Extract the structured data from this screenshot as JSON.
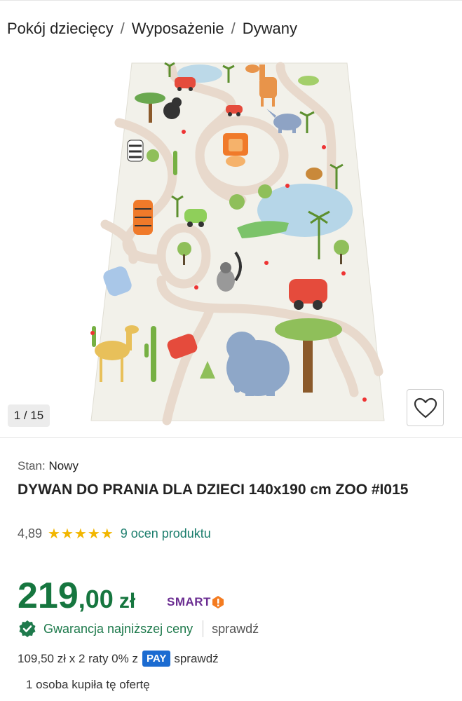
{
  "breadcrumb": {
    "items": [
      "Pokój dziecięcy",
      "Wyposażenie",
      "Dywany"
    ],
    "separator": "/"
  },
  "gallery": {
    "counter": "1 / 15",
    "image_alt": "Dywan do prania dla dzieci ZOO",
    "favorite_icon": "heart-icon"
  },
  "product": {
    "condition_label": "Stan:",
    "condition_value": "Nowy",
    "title": "DYWAN DO PRANIA DLA DZIECI 140x190 cm ZOO #I015",
    "rating_value": "4,89",
    "rating_stars": 5,
    "reviews_text": "9 ocen produktu"
  },
  "price": {
    "integer": "219",
    "decimal": ",00",
    "currency": "zł",
    "smart_label": "SMART"
  },
  "guarantee": {
    "text": "Gwarancja najniższej ceny",
    "check_link": "sprawdź"
  },
  "installments": {
    "text": "109,50 zł x 2 raty 0% z",
    "pay_badge": "PAY",
    "check_link": "sprawdź"
  },
  "purchases": {
    "text": "1 osoba kupiła tę ofertę"
  },
  "colors": {
    "price_green": "#16763f",
    "smart_purple": "#6a2c91",
    "smart_orange": "#f47b20",
    "review_teal": "#1a7d6c",
    "star_yellow": "#f2b600",
    "pay_blue": "#1b6bd1"
  }
}
